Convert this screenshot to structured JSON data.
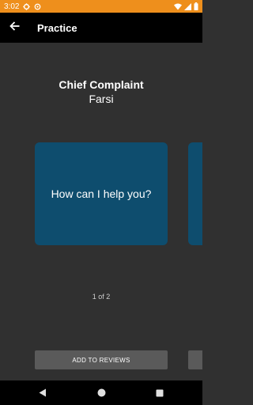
{
  "status_bar": {
    "time": "3:02",
    "background": "#ee8f1c",
    "icons_left": [
      "gear-icon",
      "sync-icon"
    ],
    "icons_right": [
      "wifi-icon",
      "signal-icon",
      "battery-icon"
    ]
  },
  "app_bar": {
    "title": "Practice",
    "back_icon": "arrow-left-icon",
    "background": "#000000"
  },
  "heading": {
    "title": "Chief Complaint",
    "subtitle": "Farsi"
  },
  "cards": [
    {
      "text": "How can I help you?",
      "color": "#0e4d6e"
    },
    {
      "text": "",
      "color": "#0e4d6e"
    }
  ],
  "pager": {
    "current": 1,
    "total": 2,
    "label": "1 of 2"
  },
  "actions": {
    "add_to_reviews_label": "ADD TO REVIEWS",
    "button_color": "#5a5a5a"
  },
  "nav_bar": {
    "icons": [
      "back-triangle-icon",
      "home-circle-icon",
      "recents-square-icon"
    ]
  }
}
